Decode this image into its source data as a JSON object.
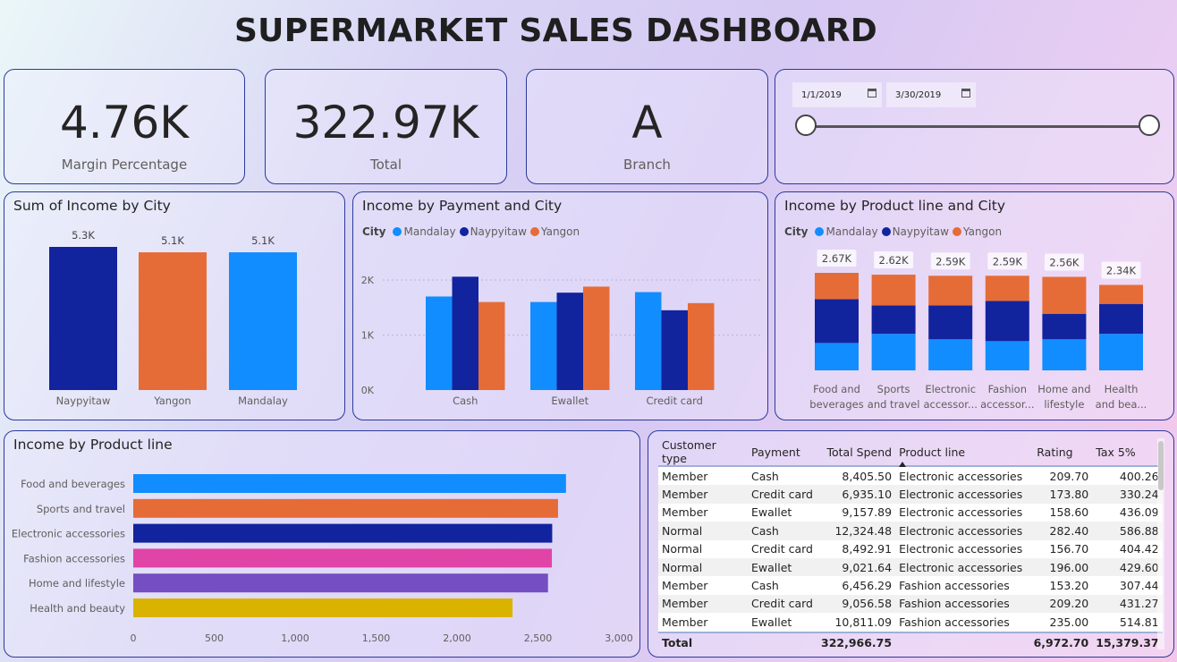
{
  "title": "SUPERMARKET SALES DASHBOARD",
  "kpis": [
    {
      "value": "4.76K",
      "label": "Margin Percentage"
    },
    {
      "value": "322.97K",
      "label": "Total"
    },
    {
      "value": "A",
      "label": "Branch"
    }
  ],
  "date_filter": {
    "start": "1/1/2019",
    "end": "3/30/2019"
  },
  "colors": {
    "mandalay": "#118dff",
    "naypyitaw": "#12239e",
    "yangon": "#e66c37",
    "pink": "#e044a7",
    "purple": "#744ec2",
    "gold": "#d9b300"
  },
  "chart_data": [
    {
      "type": "bar",
      "title": "Sum of Income by City",
      "categories": [
        "Naypyitaw",
        "Yangon",
        "Mandalay"
      ],
      "values": [
        5.3,
        5.1,
        5.1
      ],
      "data_labels": [
        "5.3K",
        "5.1K",
        "5.1K"
      ],
      "colors": [
        "#12239e",
        "#e66c37",
        "#118dff"
      ],
      "ylim": [
        0,
        5.3
      ]
    },
    {
      "type": "bar",
      "title": "Income by Payment and City",
      "legend_title": "City",
      "categories": [
        "Cash",
        "Ewallet",
        "Credit card"
      ],
      "series": [
        {
          "name": "Mandalay",
          "color": "#118dff",
          "values": [
            1700,
            1600,
            1780
          ]
        },
        {
          "name": "Naypyitaw",
          "color": "#12239e",
          "values": [
            2060,
            1770,
            1450
          ]
        },
        {
          "name": "Yangon",
          "color": "#e66c37",
          "values": [
            1600,
            1880,
            1580
          ]
        }
      ],
      "y_ticks": [
        "0K",
        "1K",
        "2K"
      ],
      "ylim": [
        0,
        2300
      ],
      "grid": true
    },
    {
      "type": "bar",
      "stacked": true,
      "title": "Income by Product line and City",
      "legend_title": "City",
      "categories": [
        "Food and beverages",
        "Sports and travel",
        "Electronic accessories",
        "Fashion accessories",
        "Home and lifestyle",
        "Health and beauty"
      ],
      "category_labels": [
        [
          "Food and",
          "beverages"
        ],
        [
          "Sports",
          "and travel"
        ],
        [
          "Electronic",
          "accessor..."
        ],
        [
          "Fashion",
          "accessor..."
        ],
        [
          "Home and",
          "lifestyle"
        ],
        [
          "Health",
          "and bea..."
        ]
      ],
      "series": [
        {
          "name": "Mandalay",
          "color": "#118dff",
          "values": [
            0.75,
            1.0,
            0.85,
            0.8,
            0.85,
            1.0
          ]
        },
        {
          "name": "Naypyitaw",
          "color": "#12239e",
          "values": [
            1.2,
            0.78,
            0.93,
            1.1,
            0.7,
            0.82
          ]
        },
        {
          "name": "Yangon",
          "color": "#e66c37",
          "values": [
            0.72,
            0.84,
            0.81,
            0.69,
            1.01,
            0.52
          ]
        }
      ],
      "totals": [
        "2.67K",
        "2.62K",
        "2.59K",
        "2.59K",
        "2.56K",
        "2.34K"
      ]
    },
    {
      "type": "bar",
      "orientation": "horizontal",
      "title": "Income by Product line",
      "categories": [
        "Food and beverages",
        "Sports and travel",
        "Electronic accessories",
        "Fashion accessories",
        "Home and lifestyle",
        "Health and beauty"
      ],
      "values": [
        2673,
        2624,
        2588,
        2586,
        2562,
        2343
      ],
      "colors": [
        "#118dff",
        "#e66c37",
        "#12239e",
        "#e044a7",
        "#744ec2",
        "#d9b300"
      ],
      "x_ticks": [
        "0",
        "500",
        "1,000",
        "1,500",
        "2,000",
        "2,500",
        "3,000"
      ],
      "xlim": [
        0,
        3000
      ]
    },
    {
      "type": "table",
      "columns": [
        "Customer type",
        "Payment",
        "Total Spend",
        "Product line",
        "Rating",
        "Tax 5%"
      ],
      "rows": [
        [
          "Member",
          "Cash",
          "8,405.50",
          "Electronic accessories",
          "209.70",
          "400.26"
        ],
        [
          "Member",
          "Credit card",
          "6,935.10",
          "Electronic accessories",
          "173.80",
          "330.24"
        ],
        [
          "Member",
          "Ewallet",
          "9,157.89",
          "Electronic accessories",
          "158.60",
          "436.09"
        ],
        [
          "Normal",
          "Cash",
          "12,324.48",
          "Electronic accessories",
          "282.40",
          "586.88"
        ],
        [
          "Normal",
          "Credit card",
          "8,492.91",
          "Electronic accessories",
          "156.70",
          "404.42"
        ],
        [
          "Normal",
          "Ewallet",
          "9,021.64",
          "Electronic accessories",
          "196.00",
          "429.60"
        ],
        [
          "Member",
          "Cash",
          "6,456.29",
          "Fashion accessories",
          "153.20",
          "307.44"
        ],
        [
          "Member",
          "Credit card",
          "9,056.58",
          "Fashion accessories",
          "209.20",
          "431.27"
        ],
        [
          "Member",
          "Ewallet",
          "10,811.09",
          "Fashion accessories",
          "235.00",
          "514.81"
        ]
      ],
      "total": [
        "Total",
        "",
        "322,966.75",
        "",
        "6,972.70",
        "15,379.37"
      ]
    }
  ]
}
